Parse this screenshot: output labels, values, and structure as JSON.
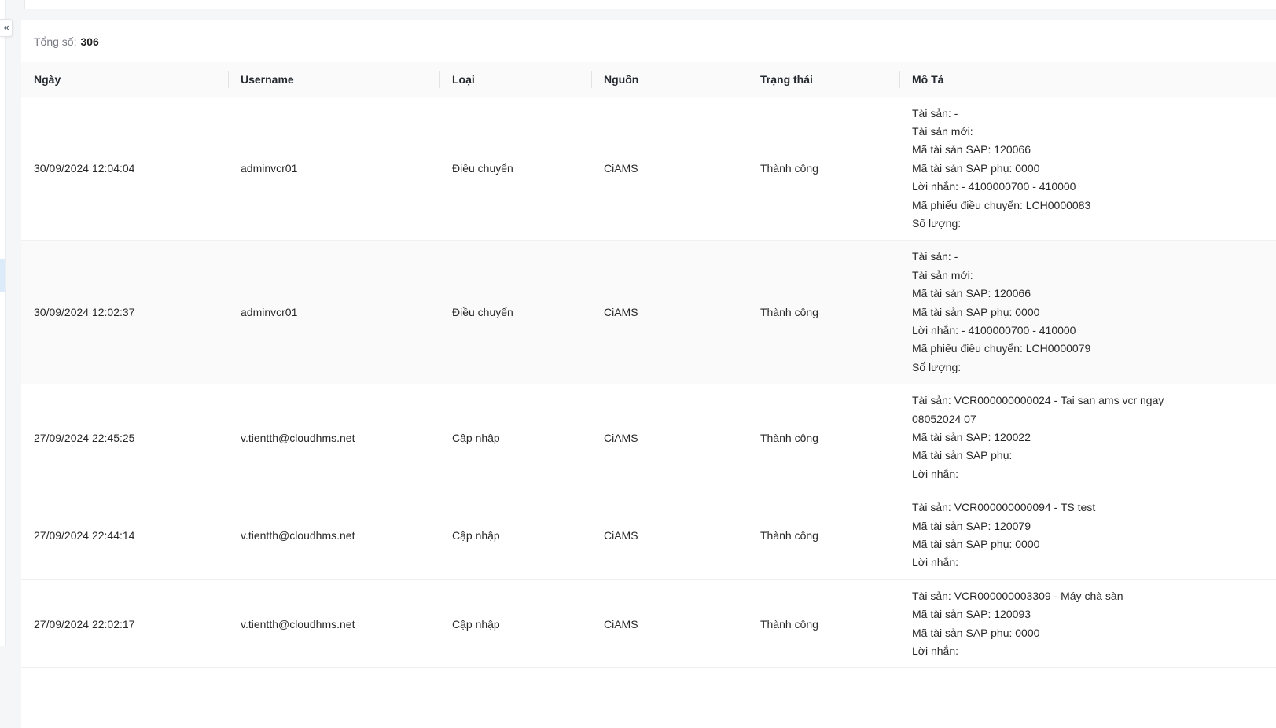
{
  "colors": {
    "page_bg": "#f5f6f8",
    "accent_light": "#dcebfa",
    "header_bg": "#fafafa",
    "row_hover_bg": "#fafafa"
  },
  "sidebar": {
    "collapse_icon": "«"
  },
  "summary": {
    "total_label": "Tổng số:",
    "total_value": "306"
  },
  "table": {
    "columns": [
      {
        "key": "date",
        "label": "Ngày"
      },
      {
        "key": "user",
        "label": "Username"
      },
      {
        "key": "type",
        "label": "Loại"
      },
      {
        "key": "source",
        "label": "Nguồn"
      },
      {
        "key": "status",
        "label": "Trạng thái"
      },
      {
        "key": "desc",
        "label": "Mô Tả"
      }
    ],
    "rows": [
      {
        "date": "30/09/2024 12:04:04",
        "username": "adminvcr01",
        "type": "Điều chuyển",
        "source": "CiAMS",
        "status": "Thành công",
        "highlighted": false,
        "description_lines": [
          "Tài sản: -",
          "Tài sản mới:",
          "Mã tài sản SAP: 120066",
          "Mã tài sản SAP phụ: 0000",
          "Lời nhắn: - 4100000700 - 410000",
          "Mã phiếu điều chuyển: LCH0000083",
          "Số lượng:"
        ]
      },
      {
        "date": "30/09/2024 12:02:37",
        "username": "adminvcr01",
        "type": "Điều chuyển",
        "source": "CiAMS",
        "status": "Thành công",
        "highlighted": true,
        "description_lines": [
          "Tài sản: -",
          "Tài sản mới:",
          "Mã tài sản SAP: 120066",
          "Mã tài sản SAP phụ: 0000",
          "Lời nhắn: - 4100000700 - 410000",
          "Mã phiếu điều chuyển: LCH0000079",
          "Số lượng:"
        ]
      },
      {
        "date": "27/09/2024 22:45:25",
        "username": "v.tientth@cloudhms.net",
        "type": "Cập nhập",
        "source": "CiAMS",
        "status": "Thành công",
        "highlighted": false,
        "description_lines": [
          "Tài sản: VCR000000000024 - Tai san ams vcr ngay",
          "08052024 07",
          "Mã tài sản SAP: 120022",
          "Mã tài sản SAP phụ:",
          "Lời nhắn:"
        ]
      },
      {
        "date": "27/09/2024 22:44:14",
        "username": "v.tientth@cloudhms.net",
        "type": "Cập nhập",
        "source": "CiAMS",
        "status": "Thành công",
        "highlighted": false,
        "description_lines": [
          "Tài sản: VCR000000000094 - TS test",
          "Mã tài sản SAP: 120079",
          "Mã tài sản SAP phụ: 0000",
          "Lời nhắn:"
        ]
      },
      {
        "date": "27/09/2024 22:02:17",
        "username": "v.tientth@cloudhms.net",
        "type": "Cập nhập",
        "source": "CiAMS",
        "status": "Thành công",
        "highlighted": false,
        "description_lines": [
          "Tài sản: VCR000000003309 - Máy chà sàn",
          "Mã tài sản SAP: 120093",
          "Mã tài sản SAP phụ: 0000",
          "Lời nhắn:"
        ]
      }
    ]
  }
}
